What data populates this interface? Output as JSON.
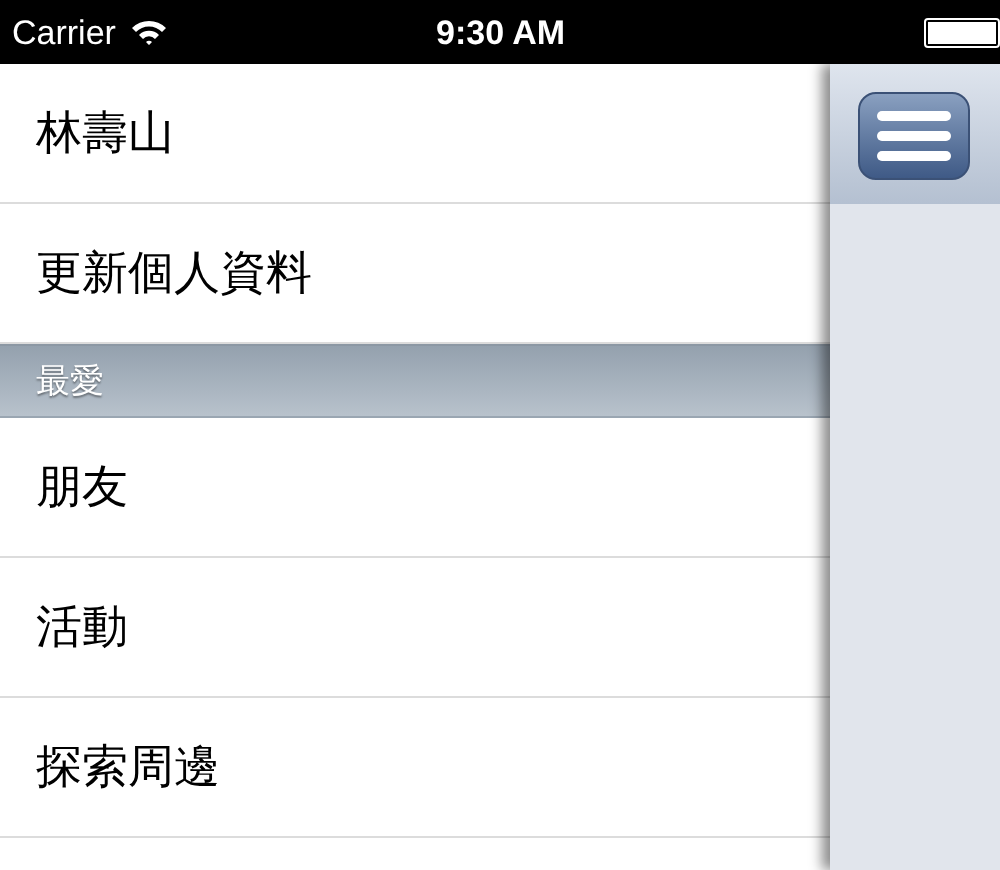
{
  "status_bar": {
    "carrier": "Carrier",
    "time": "9:30 AM"
  },
  "menu": [
    {
      "kind": "item",
      "label": "林壽山"
    },
    {
      "kind": "item",
      "label": "更新個人資料"
    },
    {
      "kind": "header",
      "label": "最愛"
    },
    {
      "kind": "item",
      "label": "朋友"
    },
    {
      "kind": "item",
      "label": "活動"
    },
    {
      "kind": "item",
      "label": "探索周邊"
    }
  ]
}
